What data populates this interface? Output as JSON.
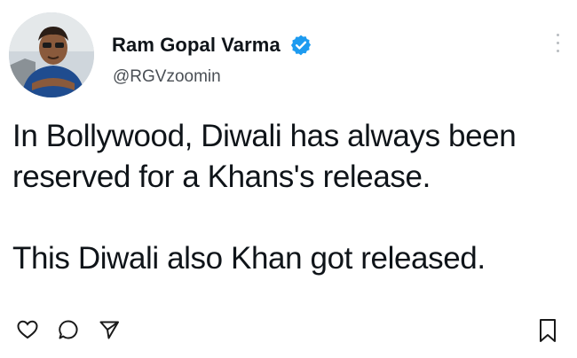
{
  "author": {
    "display_name": "Ram Gopal Varma",
    "handle": "@RGVzoomin",
    "avatar_icon": "profile-photo",
    "verified_icon": "verified-badge-icon",
    "verified_color": "#1d9bf0"
  },
  "tweet": {
    "text": "In Bollywood, Diwali has always been\nreserved for a Khans's release.\n\nThis Diwali also Khan got released."
  },
  "actions": {
    "items": [
      {
        "icon": "heart-icon"
      },
      {
        "icon": "reply-icon"
      },
      {
        "icon": "share-icon"
      }
    ],
    "bookmark_icon": "bookmark-icon"
  },
  "menu": {
    "icon": "more-options-icon"
  }
}
